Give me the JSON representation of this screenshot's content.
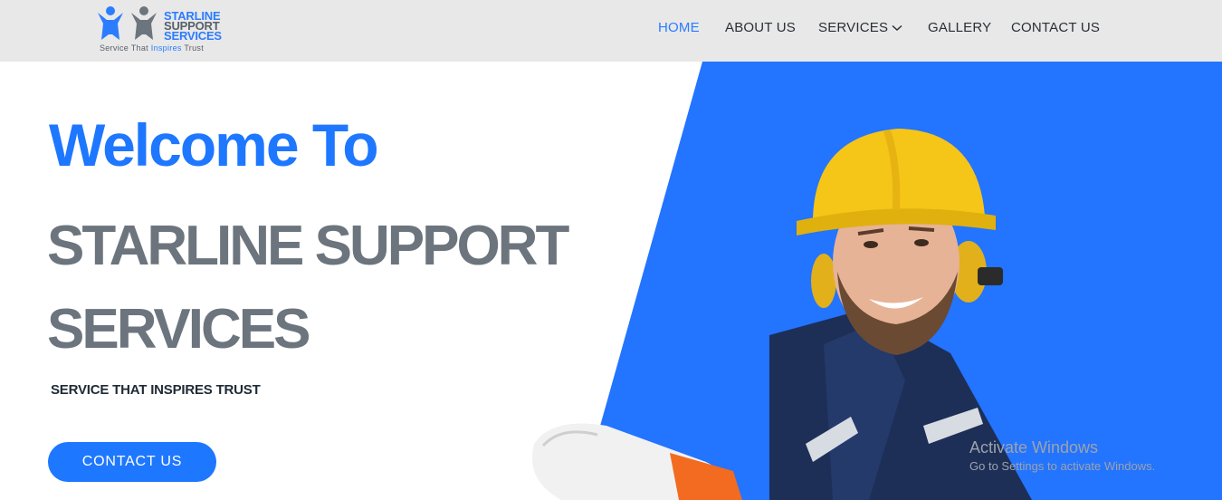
{
  "logo": {
    "line1": "STARLINE",
    "line2": "SUPPORT",
    "line3": "SERVICES",
    "tagline_start": "Service That ",
    "tagline_highlight": "Inspires",
    "tagline_end": " Trust"
  },
  "nav": {
    "items": [
      "HOME",
      "ABOUT US",
      "SERVICES",
      "GALLERY",
      "CONTACT US"
    ],
    "active": "HOME"
  },
  "hero": {
    "welcome": "Welcome To",
    "brand_line1": "STARLINE SUPPORT",
    "brand_line2": "SERVICES",
    "tagline": "SERVICE THAT INSPIRES TRUST",
    "cta_label": "CONTACT US"
  },
  "watermark": {
    "title": "Activate Windows",
    "subtitle": "Go to Settings to activate Windows."
  },
  "colors": {
    "accent": "#1e77ff",
    "panel_blue": "#2374ff",
    "header_bg": "#e8e8e8",
    "brand_gray": "#6c757d",
    "helmet_yellow": "#f5c518",
    "uniform_navy": "#1d2f57"
  },
  "icons": {
    "logo": "two-people-figures-icon",
    "dropdown": "chevron-down-icon"
  }
}
